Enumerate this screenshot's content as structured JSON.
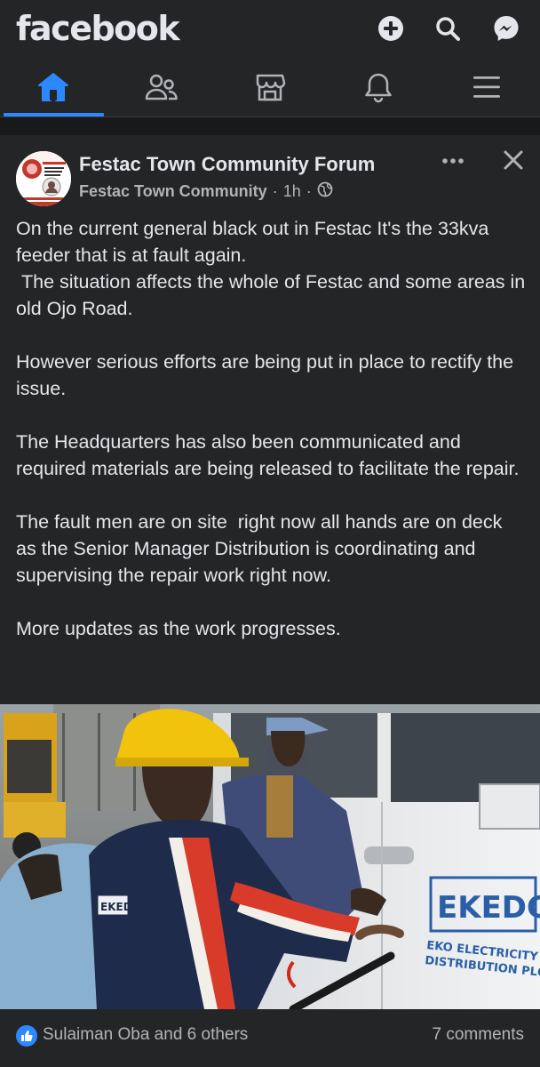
{
  "app": {
    "logo_text": "facebook"
  },
  "top_actions": [
    "create-icon",
    "search-icon",
    "messenger-icon"
  ],
  "nav": {
    "items": [
      "home-icon",
      "friends-icon",
      "marketplace-icon",
      "notifications-icon",
      "menu-icon"
    ],
    "active": "home-icon",
    "accent_color": "#2d88ff"
  },
  "post": {
    "group_name": "Festac Town Community Forum",
    "author": "Festac Town Community",
    "time": "1h",
    "privacy_icon": "globe-icon",
    "body": "On the current general black out in Festac It's the 33kva feeder that is at fault again.\n The situation affects the whole of Festac and some areas in old Ojo Road.\n\nHowever serious efforts are being put in place to rectify the issue.\n\nThe Headquarters has also been communicated and required materials are being released to facilitate the repair.\n\nThe fault men are on site  right now all hands are on deck as the Senior Manager Distribution is coordinating and supervising the repair work right now.\n\nMore updates as the work progresses.",
    "photo": {
      "van_brand": "EKEDC",
      "van_text_line1": "EKO ELECTRICITY",
      "van_text_line2": "DISTRIBUTION PLC",
      "uniform_badge": "EKEDC"
    },
    "reactions_text": "Sulaiman Oba and 6 others",
    "comments_text": "7 comments"
  },
  "colors": {
    "background": "#18191a",
    "surface": "#242526",
    "text_primary": "#e4e6eb",
    "text_secondary": "#b0b3b8"
  }
}
